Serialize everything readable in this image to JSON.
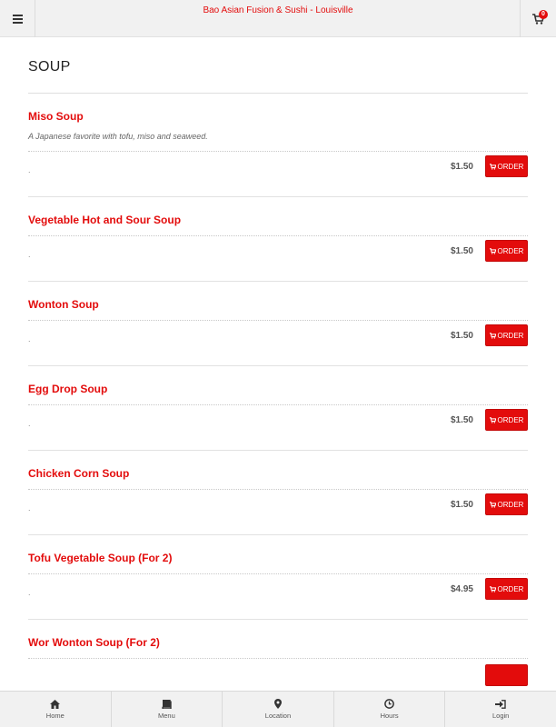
{
  "header": {
    "title": "Bao Asian Fusion & Sushi - Louisville",
    "cart_count": "0"
  },
  "section": {
    "title": "SOUP"
  },
  "items": [
    {
      "name": "Miso Soup",
      "description": "A Japanese favorite with tofu, miso and seaweed.",
      "price": "$1.50",
      "order_label": "ORDER"
    },
    {
      "name": "Vegetable Hot and Sour Soup",
      "price": "$1.50",
      "order_label": "ORDER"
    },
    {
      "name": "Wonton Soup",
      "price": "$1.50",
      "order_label": "ORDER"
    },
    {
      "name": "Egg Drop Soup",
      "price": "$1.50",
      "order_label": "ORDER"
    },
    {
      "name": "Chicken Corn Soup",
      "price": "$1.50",
      "order_label": "ORDER"
    },
    {
      "name": "Tofu Vegetable Soup (For 2)",
      "price": "$4.95",
      "order_label": "ORDER"
    },
    {
      "name": "Wor Wonton Soup (For 2)"
    }
  ],
  "bottom_nav": [
    {
      "label": "Home",
      "icon": "home-icon"
    },
    {
      "label": "Menu",
      "icon": "book-icon"
    },
    {
      "label": "Location",
      "icon": "map-marker-icon"
    },
    {
      "label": "Hours",
      "icon": "clock-icon"
    },
    {
      "label": "Login",
      "icon": "sign-in-icon"
    }
  ],
  "colors": {
    "accent": "#e30c0c",
    "bar_bg": "#f1f1f1"
  }
}
